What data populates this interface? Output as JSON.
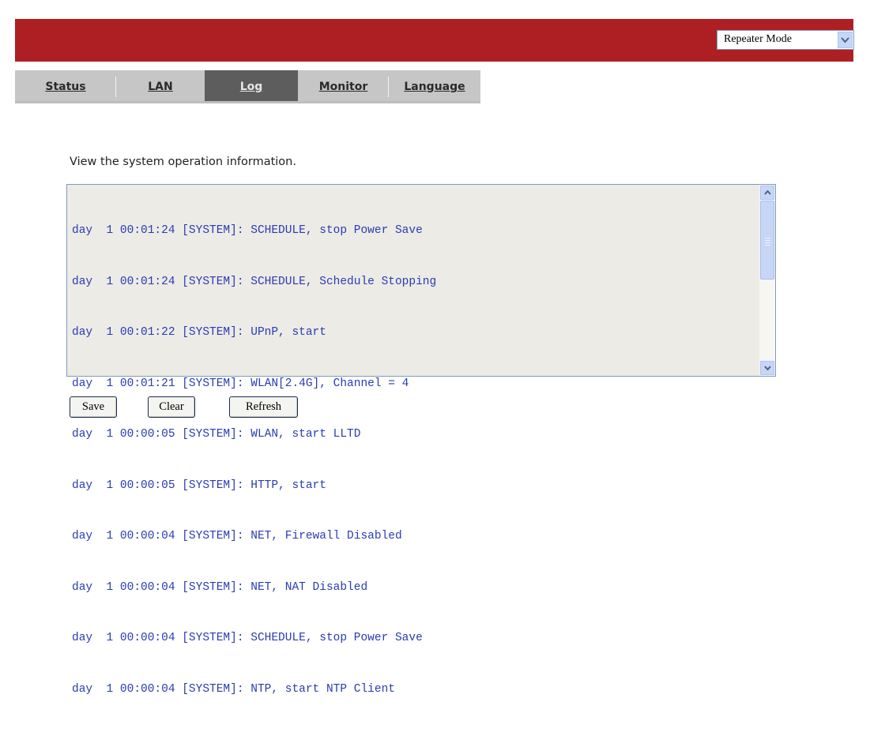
{
  "header": {
    "mode_select": {
      "value": "Repeater Mode",
      "icon": "chevron-down-icon"
    },
    "bar_color": "#ae1f24"
  },
  "tabs": [
    {
      "label": "Status",
      "active": false
    },
    {
      "label": "LAN",
      "active": false
    },
    {
      "label": "Log",
      "active": true
    },
    {
      "label": "Monitor",
      "active": false
    },
    {
      "label": "Language",
      "active": false
    }
  ],
  "page": {
    "description": "View the system operation information."
  },
  "log": {
    "lines": [
      "day  1 00:01:24 [SYSTEM]: SCHEDULE, stop Power Save",
      "day  1 00:01:24 [SYSTEM]: SCHEDULE, Schedule Stopping",
      "day  1 00:01:22 [SYSTEM]: UPnP, start",
      "day  1 00:01:21 [SYSTEM]: WLAN[2.4G], Channel = 4",
      "day  1 00:00:05 [SYSTEM]: WLAN, start LLTD",
      "day  1 00:00:05 [SYSTEM]: HTTP, start",
      "day  1 00:00:04 [SYSTEM]: NET, Firewall Disabled",
      "day  1 00:00:04 [SYSTEM]: NET, NAT Disabled",
      "day  1 00:00:04 [SYSTEM]: SCHEDULE, stop Power Save",
      "day  1 00:00:04 [SYSTEM]: NTP, start NTP Client"
    ],
    "text_color": "#2a3bb3"
  },
  "buttons": {
    "save": "Save",
    "clear": "Clear",
    "refresh": "Refresh"
  }
}
